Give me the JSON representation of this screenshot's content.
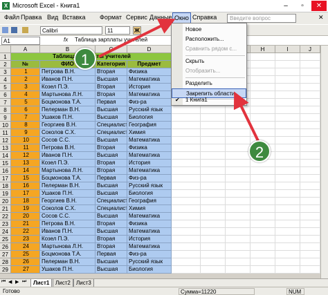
{
  "window": {
    "title": "Microsoft Excel - Книга1",
    "app_icon": "X",
    "controls": [
      "–",
      "▫",
      "✕"
    ]
  },
  "menu": {
    "items": [
      "Файл",
      "Правка",
      "Вид",
      "Вставка",
      "Формат",
      "Сервис",
      "Данные",
      "Окно",
      "Справка"
    ],
    "search_placeholder": "Введите вопрос",
    "close_glyph": "✕"
  },
  "toolbar": {
    "font": "Calibri",
    "size": "11",
    "bold": "Ж"
  },
  "formula": {
    "cell_ref": "A1",
    "fx": "fx",
    "content": "Таблица зарплаты учителей"
  },
  "columns": [
    "A",
    "B",
    "C",
    "D",
    "E",
    "F",
    "G",
    "H",
    "I",
    "J"
  ],
  "table": {
    "title": "Таблица зарплаты учителей",
    "headers": [
      "№",
      "ФИО",
      "Категория",
      "Предмет"
    ],
    "rows": [
      [
        "1",
        "Петрова В.Н.",
        "Вторая",
        "Физика"
      ],
      [
        "2",
        "Иванов П.Н.",
        "Высшая",
        "Математика"
      ],
      [
        "3",
        "Козел П.Э.",
        "Вторая",
        "История"
      ],
      [
        "4",
        "Мартынова Л.Н.",
        "Вторая",
        "Математика"
      ],
      [
        "5",
        "Боцмонова Т.А.",
        "Первая",
        "Физ-ра"
      ],
      [
        "6",
        "Пелерман В.Н.",
        "Высшая",
        "Русский язык"
      ],
      [
        "7",
        "Ушаков П.Н.",
        "Высшая",
        "Биология"
      ],
      [
        "8",
        "Георгиев В.Н.",
        "Специалист",
        "География"
      ],
      [
        "9",
        "Соколов С.Х.",
        "Специалист",
        "Химия"
      ],
      [
        "10",
        "Сосов С.С.",
        "Высшая",
        "Математика"
      ],
      [
        "11",
        "Петрова В.Н.",
        "Вторая",
        "Физика"
      ],
      [
        "12",
        "Иванов П.Н.",
        "Высшая",
        "Математика"
      ],
      [
        "13",
        "Козел П.Э.",
        "Вторая",
        "История"
      ],
      [
        "14",
        "Мартынова Л.Н.",
        "Вторая",
        "Математика"
      ],
      [
        "15",
        "Боцмонова Т.А.",
        "Первая",
        "Физ-ра"
      ],
      [
        "16",
        "Пелерман В.Н.",
        "Высшая",
        "Русский язык"
      ],
      [
        "17",
        "Ушаков П.Н.",
        "Высшая",
        "Биология"
      ],
      [
        "18",
        "Георгиев В.Н.",
        "Специалист",
        "География"
      ],
      [
        "19",
        "Соколов С.Х.",
        "Специалист",
        "Химия"
      ],
      [
        "20",
        "Сосов С.С.",
        "Высшая",
        "Математика"
      ],
      [
        "21",
        "Петрова В.Н.",
        "Вторая",
        "Физика"
      ],
      [
        "22",
        "Иванов П.Н.",
        "Высшая",
        "Математика"
      ],
      [
        "23",
        "Козел П.Э.",
        "Вторая",
        "История"
      ],
      [
        "24",
        "Мартынова Л.Н.",
        "Вторая",
        "Математика"
      ],
      [
        "25",
        "Боцмонова Т.А.",
        "Первая",
        "Физ-ра"
      ],
      [
        "26",
        "Пелерман В.Н.",
        "Высшая",
        "Русский язык"
      ],
      [
        "27",
        "Ушаков П.Н.",
        "Высшая",
        "Биология"
      ]
    ]
  },
  "dropdown": {
    "items": [
      {
        "label": "Новое",
        "disabled": false
      },
      {
        "label": "Расположить...",
        "disabled": false
      },
      {
        "label": "Сравнить рядом с...",
        "disabled": true
      },
      {
        "label": "Скрыть",
        "disabled": false
      },
      {
        "label": "Отобразить...",
        "disabled": true
      },
      {
        "label": "Разделить",
        "disabled": false
      },
      {
        "label": "Закрепить области",
        "disabled": false,
        "highlight": true
      },
      {
        "label": "1 Книга1",
        "disabled": false,
        "checked": true
      }
    ]
  },
  "sheets": {
    "nav": [
      "⏮",
      "◀",
      "▶",
      "⏭"
    ],
    "tabs": [
      "Лист1",
      "Лист2",
      "Лист3"
    ]
  },
  "status": {
    "ready": "Готово",
    "sum": "Сумма=11220",
    "num": "NUM"
  },
  "annotations": [
    "1",
    "2"
  ],
  "colors": {
    "accent": "#3b64b8",
    "arrow": "#e2333d",
    "badge": "#3e8a3f",
    "table_fill": "#aecbf0",
    "index_fill": "#f5a623",
    "header_fill": "#9bbb3f"
  }
}
